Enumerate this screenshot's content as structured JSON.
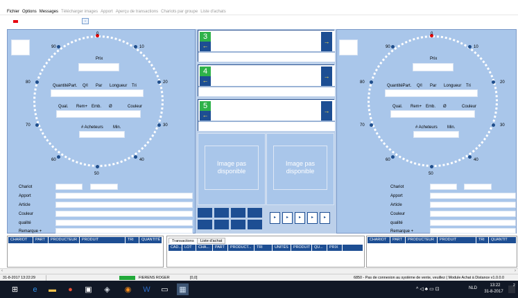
{
  "menu": {
    "items": [
      {
        "label": "Fichier",
        "enabled": true
      },
      {
        "label": "Options",
        "enabled": true
      },
      {
        "label": "Messages",
        "enabled": true
      },
      {
        "label": "Télécharger images",
        "enabled": false
      },
      {
        "label": "Apport",
        "enabled": false
      },
      {
        "label": "Aperçu de transactions",
        "enabled": false
      },
      {
        "label": "Chariots par groupe",
        "enabled": false
      },
      {
        "label": "Liste d'achats",
        "enabled": false
      }
    ]
  },
  "clock": {
    "numbers": [
      "0",
      "10",
      "20",
      "30",
      "40",
      "50",
      "60",
      "70",
      "80",
      "90"
    ],
    "prix_label": "Prix",
    "row1_labels": [
      "QuantitéPart.",
      "Q/l",
      "Par",
      "Longueur",
      "Tri"
    ],
    "row2_labels": [
      "Qual.",
      "Rem+",
      "Emb.",
      "Ø",
      "Couleur"
    ],
    "row3_labels": [
      "# Acheteurs",
      "Min."
    ]
  },
  "details": {
    "labels": [
      "Chariot",
      "Apport",
      "Article",
      "Couleur",
      "qualité",
      "Remarque +"
    ]
  },
  "lots": [
    {
      "number": "3",
      "left_arrow": "←",
      "right_arrow": "→"
    },
    {
      "number": "4",
      "left_arrow": "←",
      "right_arrow": "→"
    },
    {
      "number": "5",
      "left_arrow": "←",
      "right_arrow": "→"
    }
  ],
  "image_placeholder": {
    "left_text": "Image pas disponible",
    "right_text": "Image pas disponible"
  },
  "grid_left": {
    "columns": [
      "CHARIOT",
      "PART",
      "PRODUCTEUR",
      "PRODUIT",
      "TRI",
      "QUANTITÉ"
    ]
  },
  "grid_right": {
    "columns": [
      "CHARIOT",
      "PART",
      "PRODUCTEUR",
      "PRODUIT",
      "TRI",
      "QUANTIT"
    ]
  },
  "tabs": {
    "items": [
      "Transactions",
      "Liste d'achat"
    ],
    "active": "Transactions",
    "columns": [
      "CAD...",
      "LOT",
      "CHA...",
      "PART",
      "PRODUCT...",
      "TRI",
      "UNITÉS",
      "PRODUIT",
      "QU...",
      "PRIX"
    ]
  },
  "status": {
    "datetime": "31-8-2017 13:22:29",
    "user": "FIERENS ROGER",
    "coords": "[0,0]",
    "message": "6850 - Pas de connexion au système de vente, veuillez ( Module Achat à Distance v1.0.0.0"
  },
  "taskbar": {
    "lang": "NLD",
    "time": "13:22",
    "date": "31-8-2017",
    "notif_count": "2"
  },
  "colors": {
    "panel_bg": "#a9c6ea",
    "dark_blue": "#1d4e93",
    "lot_green": "#2fb24a",
    "arrow_yellow": "#ffe14d",
    "status_green": "#22a93a"
  }
}
